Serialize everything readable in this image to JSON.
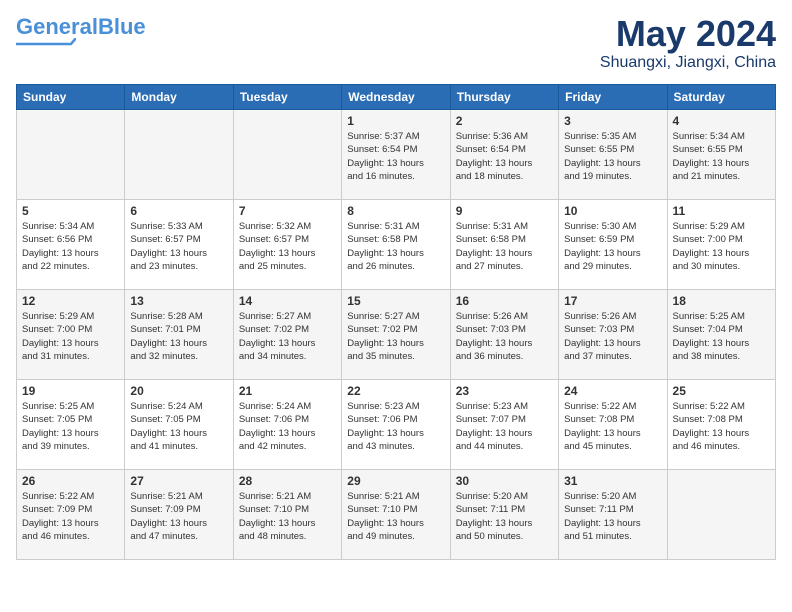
{
  "header": {
    "logo_line1": "General",
    "logo_line2": "Blue",
    "month": "May 2024",
    "location": "Shuangxi, Jiangxi, China"
  },
  "days_of_week": [
    "Sunday",
    "Monday",
    "Tuesday",
    "Wednesday",
    "Thursday",
    "Friday",
    "Saturday"
  ],
  "weeks": [
    [
      {
        "day": "",
        "info": ""
      },
      {
        "day": "",
        "info": ""
      },
      {
        "day": "",
        "info": ""
      },
      {
        "day": "1",
        "info": "Sunrise: 5:37 AM\nSunset: 6:54 PM\nDaylight: 13 hours\nand 16 minutes."
      },
      {
        "day": "2",
        "info": "Sunrise: 5:36 AM\nSunset: 6:54 PM\nDaylight: 13 hours\nand 18 minutes."
      },
      {
        "day": "3",
        "info": "Sunrise: 5:35 AM\nSunset: 6:55 PM\nDaylight: 13 hours\nand 19 minutes."
      },
      {
        "day": "4",
        "info": "Sunrise: 5:34 AM\nSunset: 6:55 PM\nDaylight: 13 hours\nand 21 minutes."
      }
    ],
    [
      {
        "day": "5",
        "info": "Sunrise: 5:34 AM\nSunset: 6:56 PM\nDaylight: 13 hours\nand 22 minutes."
      },
      {
        "day": "6",
        "info": "Sunrise: 5:33 AM\nSunset: 6:57 PM\nDaylight: 13 hours\nand 23 minutes."
      },
      {
        "day": "7",
        "info": "Sunrise: 5:32 AM\nSunset: 6:57 PM\nDaylight: 13 hours\nand 25 minutes."
      },
      {
        "day": "8",
        "info": "Sunrise: 5:31 AM\nSunset: 6:58 PM\nDaylight: 13 hours\nand 26 minutes."
      },
      {
        "day": "9",
        "info": "Sunrise: 5:31 AM\nSunset: 6:58 PM\nDaylight: 13 hours\nand 27 minutes."
      },
      {
        "day": "10",
        "info": "Sunrise: 5:30 AM\nSunset: 6:59 PM\nDaylight: 13 hours\nand 29 minutes."
      },
      {
        "day": "11",
        "info": "Sunrise: 5:29 AM\nSunset: 7:00 PM\nDaylight: 13 hours\nand 30 minutes."
      }
    ],
    [
      {
        "day": "12",
        "info": "Sunrise: 5:29 AM\nSunset: 7:00 PM\nDaylight: 13 hours\nand 31 minutes."
      },
      {
        "day": "13",
        "info": "Sunrise: 5:28 AM\nSunset: 7:01 PM\nDaylight: 13 hours\nand 32 minutes."
      },
      {
        "day": "14",
        "info": "Sunrise: 5:27 AM\nSunset: 7:02 PM\nDaylight: 13 hours\nand 34 minutes."
      },
      {
        "day": "15",
        "info": "Sunrise: 5:27 AM\nSunset: 7:02 PM\nDaylight: 13 hours\nand 35 minutes."
      },
      {
        "day": "16",
        "info": "Sunrise: 5:26 AM\nSunset: 7:03 PM\nDaylight: 13 hours\nand 36 minutes."
      },
      {
        "day": "17",
        "info": "Sunrise: 5:26 AM\nSunset: 7:03 PM\nDaylight: 13 hours\nand 37 minutes."
      },
      {
        "day": "18",
        "info": "Sunrise: 5:25 AM\nSunset: 7:04 PM\nDaylight: 13 hours\nand 38 minutes."
      }
    ],
    [
      {
        "day": "19",
        "info": "Sunrise: 5:25 AM\nSunset: 7:05 PM\nDaylight: 13 hours\nand 39 minutes."
      },
      {
        "day": "20",
        "info": "Sunrise: 5:24 AM\nSunset: 7:05 PM\nDaylight: 13 hours\nand 41 minutes."
      },
      {
        "day": "21",
        "info": "Sunrise: 5:24 AM\nSunset: 7:06 PM\nDaylight: 13 hours\nand 42 minutes."
      },
      {
        "day": "22",
        "info": "Sunrise: 5:23 AM\nSunset: 7:06 PM\nDaylight: 13 hours\nand 43 minutes."
      },
      {
        "day": "23",
        "info": "Sunrise: 5:23 AM\nSunset: 7:07 PM\nDaylight: 13 hours\nand 44 minutes."
      },
      {
        "day": "24",
        "info": "Sunrise: 5:22 AM\nSunset: 7:08 PM\nDaylight: 13 hours\nand 45 minutes."
      },
      {
        "day": "25",
        "info": "Sunrise: 5:22 AM\nSunset: 7:08 PM\nDaylight: 13 hours\nand 46 minutes."
      }
    ],
    [
      {
        "day": "26",
        "info": "Sunrise: 5:22 AM\nSunset: 7:09 PM\nDaylight: 13 hours\nand 46 minutes."
      },
      {
        "day": "27",
        "info": "Sunrise: 5:21 AM\nSunset: 7:09 PM\nDaylight: 13 hours\nand 47 minutes."
      },
      {
        "day": "28",
        "info": "Sunrise: 5:21 AM\nSunset: 7:10 PM\nDaylight: 13 hours\nand 48 minutes."
      },
      {
        "day": "29",
        "info": "Sunrise: 5:21 AM\nSunset: 7:10 PM\nDaylight: 13 hours\nand 49 minutes."
      },
      {
        "day": "30",
        "info": "Sunrise: 5:20 AM\nSunset: 7:11 PM\nDaylight: 13 hours\nand 50 minutes."
      },
      {
        "day": "31",
        "info": "Sunrise: 5:20 AM\nSunset: 7:11 PM\nDaylight: 13 hours\nand 51 minutes."
      },
      {
        "day": "",
        "info": ""
      }
    ]
  ]
}
